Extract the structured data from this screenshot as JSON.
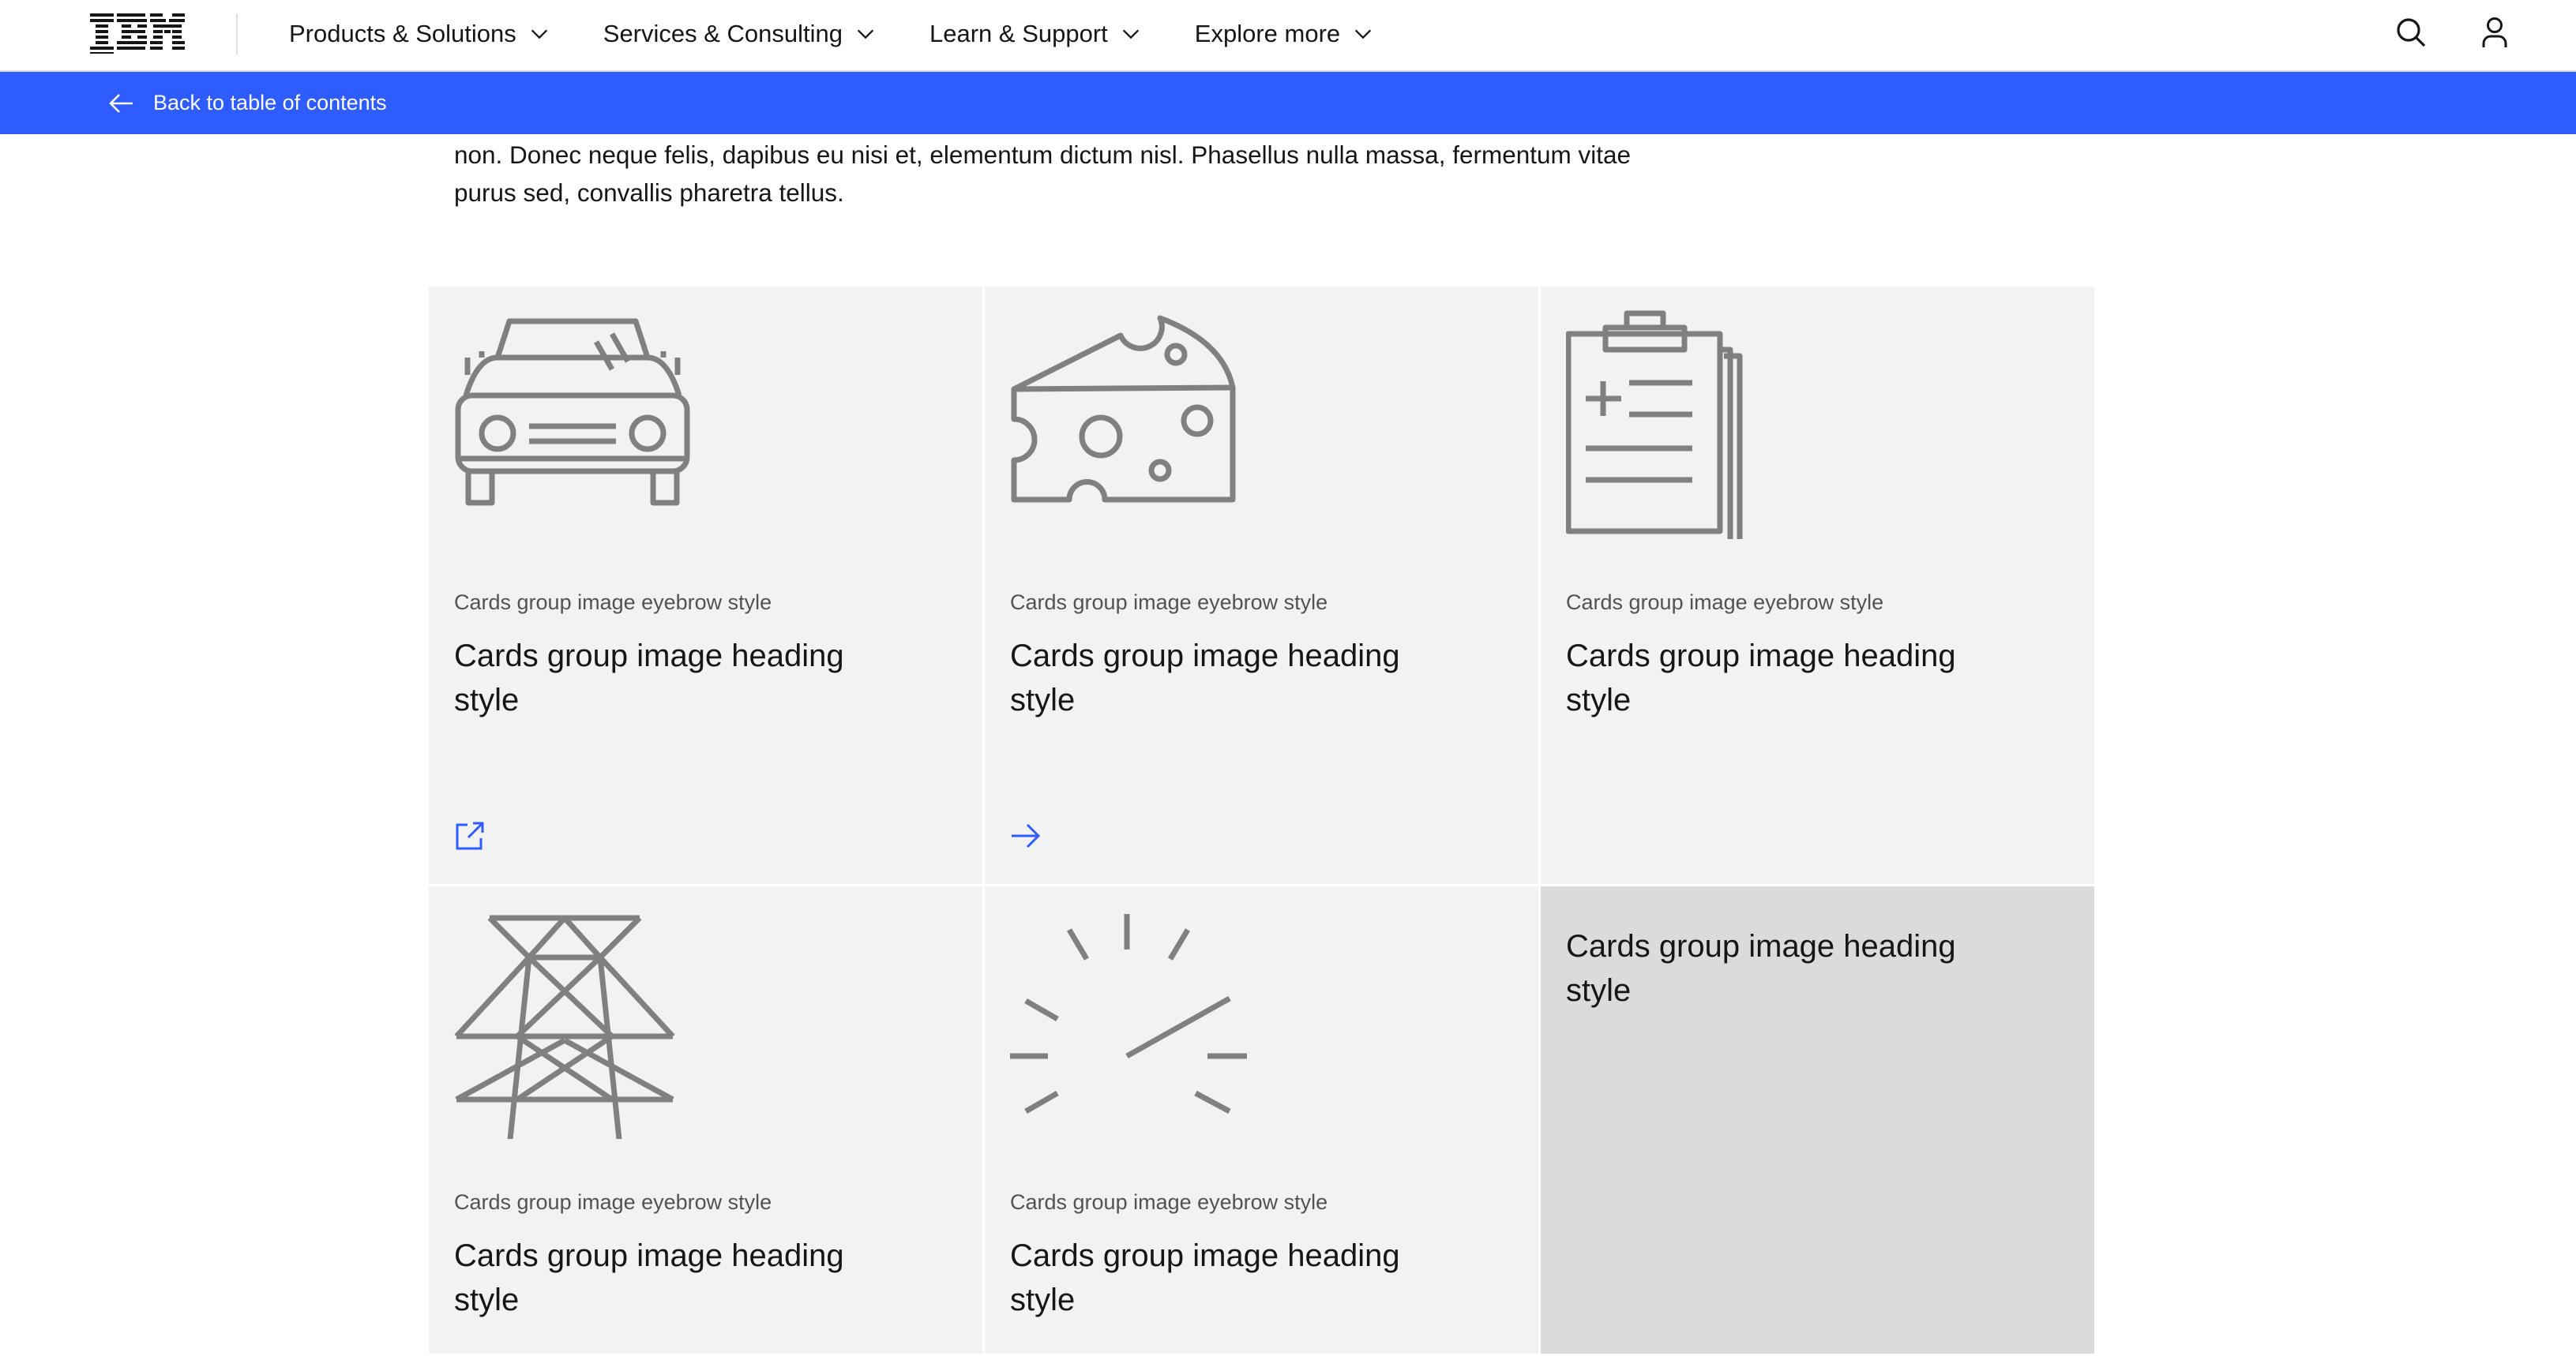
{
  "brand": {
    "logo": "IBM",
    "accent": "#2f5cff"
  },
  "nav": {
    "items": [
      {
        "label": "Products & Solutions"
      },
      {
        "label": "Services & Consulting"
      },
      {
        "label": "Learn & Support"
      },
      {
        "label": "Explore more"
      }
    ],
    "icons": [
      "search-icon",
      "user-icon"
    ]
  },
  "subbar": {
    "back_label": "Back to table of contents"
  },
  "intro": {
    "text": "non. Donec neque felis, dapibus eu nisi et, elementum dictum nisl. Phasellus nulla massa, fermentum vitae purus sed, convallis pharetra tellus."
  },
  "cards": [
    {
      "icon": "car-icon",
      "eyebrow": "Cards group image eyebrow style",
      "heading": "Cards group image heading style",
      "footer_icon": "launch-icon"
    },
    {
      "icon": "cheese-icon",
      "eyebrow": "Cards group image eyebrow style",
      "heading": "Cards group image heading style",
      "footer_icon": "arrow-right-icon"
    },
    {
      "icon": "clipboard-icon",
      "eyebrow": "Cards group image eyebrow style",
      "heading": "Cards group image heading style"
    },
    {
      "icon": "power-tower-icon",
      "eyebrow": "Cards group image eyebrow style",
      "heading": "Cards group image heading style"
    },
    {
      "icon": "sparkle-icon",
      "eyebrow": "Cards group image eyebrow style",
      "heading": "Cards group image heading style"
    },
    {
      "heading": "Cards group image heading style"
    }
  ]
}
